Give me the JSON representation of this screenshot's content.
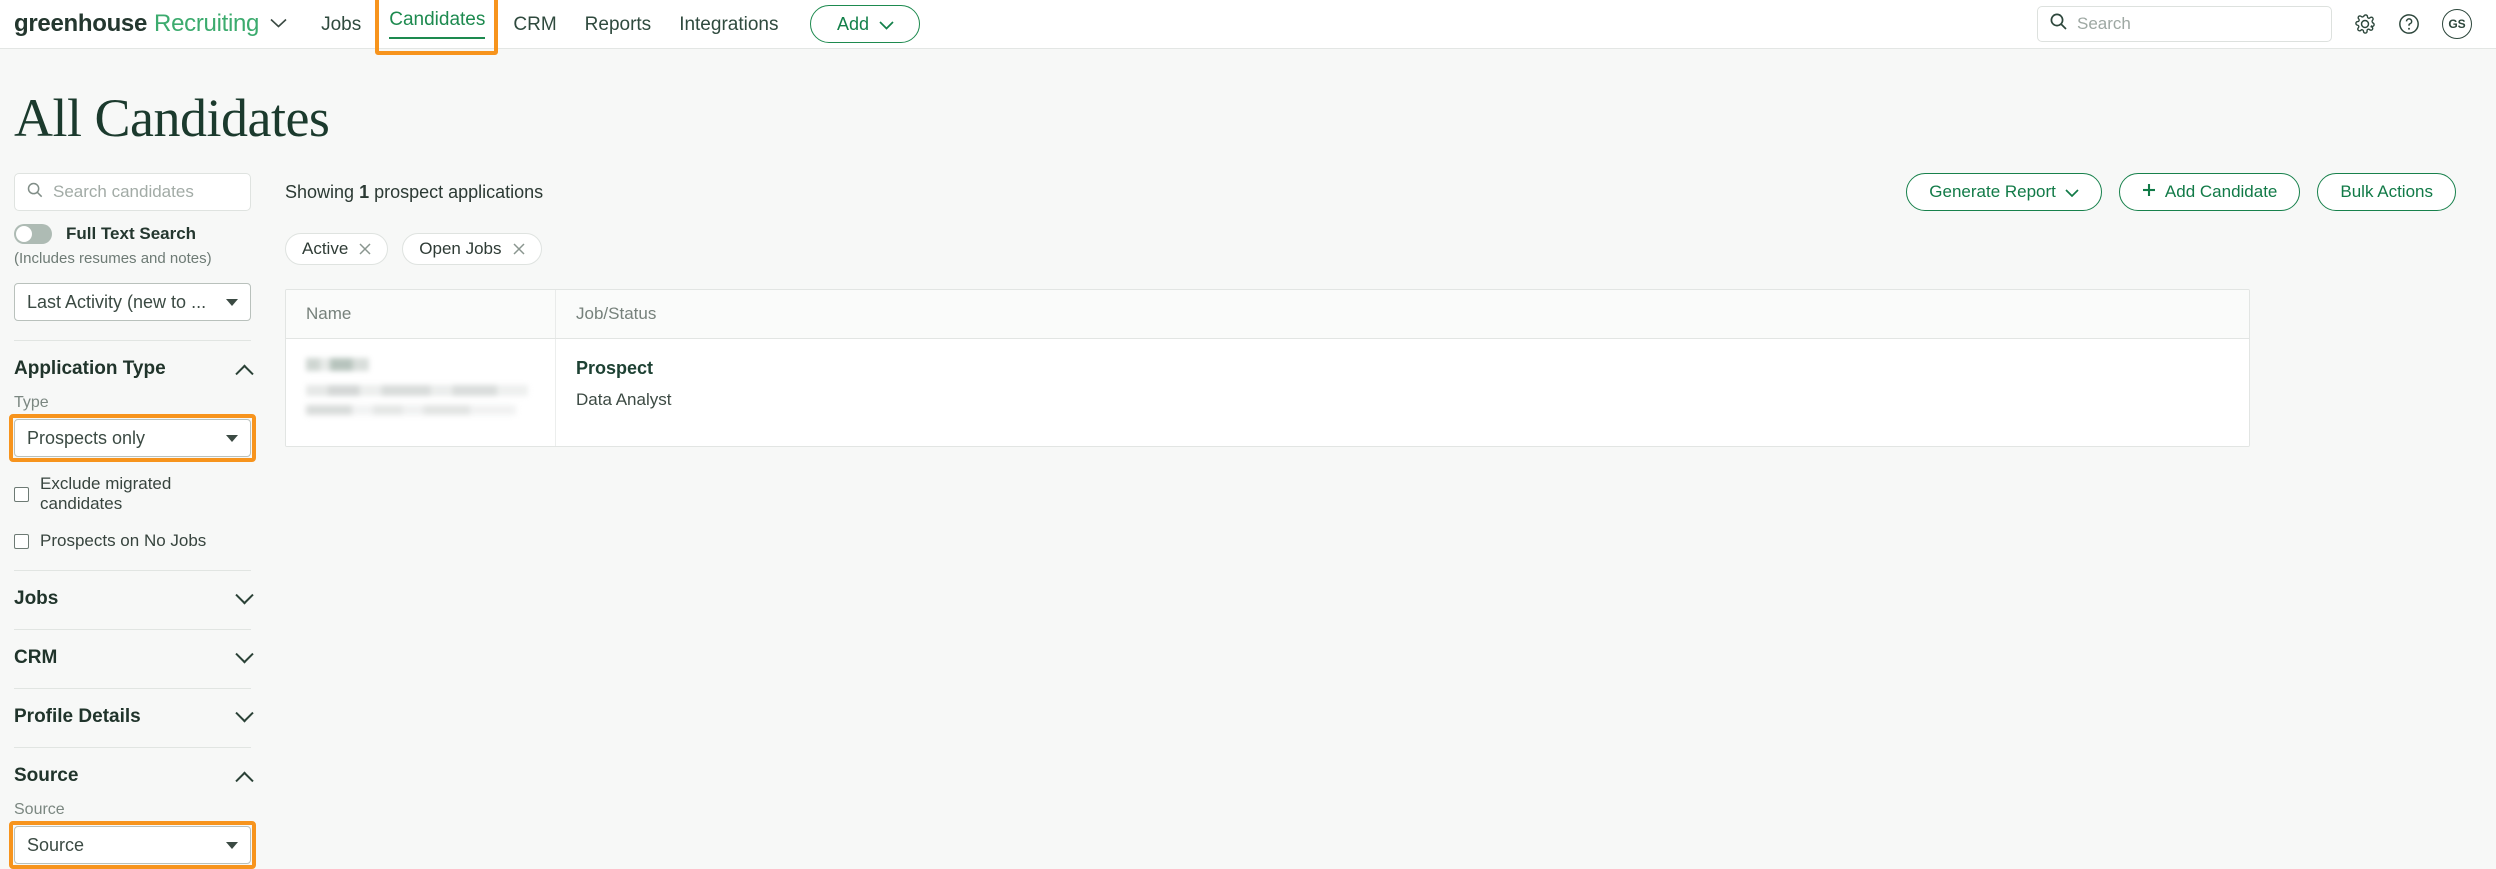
{
  "topnav": {
    "brand_primary": "greenhouse",
    "brand_secondary": "Recruiting",
    "links": [
      {
        "label": "Jobs",
        "active": false
      },
      {
        "label": "Candidates",
        "active": true
      },
      {
        "label": "CRM",
        "active": false
      },
      {
        "label": "Reports",
        "active": false
      },
      {
        "label": "Integrations",
        "active": false
      }
    ],
    "add_button": "Add",
    "search_placeholder": "Search",
    "search_value": "",
    "avatar_initials": "GS"
  },
  "page": {
    "title": "All Candidates"
  },
  "sidebar": {
    "search_placeholder": "Search candidates",
    "search_value": "",
    "full_text_search_label": "Full Text Search",
    "full_text_search_sub": "(Includes resumes and notes)",
    "full_text_search_on": false,
    "sort_value": "Last Activity (new to ...",
    "sections": [
      {
        "title": "Application Type",
        "expanded": true,
        "field_label": "Type",
        "field_value": "Prospects only",
        "highlighted": true,
        "checkboxes": [
          {
            "label": "Exclude migrated candidates",
            "checked": false
          },
          {
            "label": "Prospects on No Jobs",
            "checked": false
          }
        ]
      },
      {
        "title": "Jobs",
        "expanded": false
      },
      {
        "title": "CRM",
        "expanded": false
      },
      {
        "title": "Profile Details",
        "expanded": false
      },
      {
        "title": "Source",
        "expanded": true,
        "field_label": "Source",
        "field_value": "Source",
        "highlighted": true
      }
    ]
  },
  "content": {
    "showing_prefix": "Showing ",
    "showing_count": "1",
    "showing_suffix": " prospect applications",
    "actions": [
      {
        "label": "Generate Report",
        "icon": "chevron-down-icon"
      },
      {
        "label": "Add Candidate",
        "icon": "plus-icon"
      },
      {
        "label": "Bulk Actions",
        "icon": ""
      }
    ],
    "chips": [
      {
        "label": "Active"
      },
      {
        "label": "Open Jobs"
      }
    ],
    "table": {
      "columns": [
        "Name",
        "Job/Status"
      ],
      "rows": [
        {
          "name_redacted": true,
          "job_status": "Prospect",
          "job_title": "Data Analyst"
        }
      ]
    }
  },
  "colors": {
    "brand_green": "#3cab6e",
    "dark_green": "#1b3a2d",
    "highlight_orange": "#f7941d",
    "page_background": "#f7f8f7"
  }
}
